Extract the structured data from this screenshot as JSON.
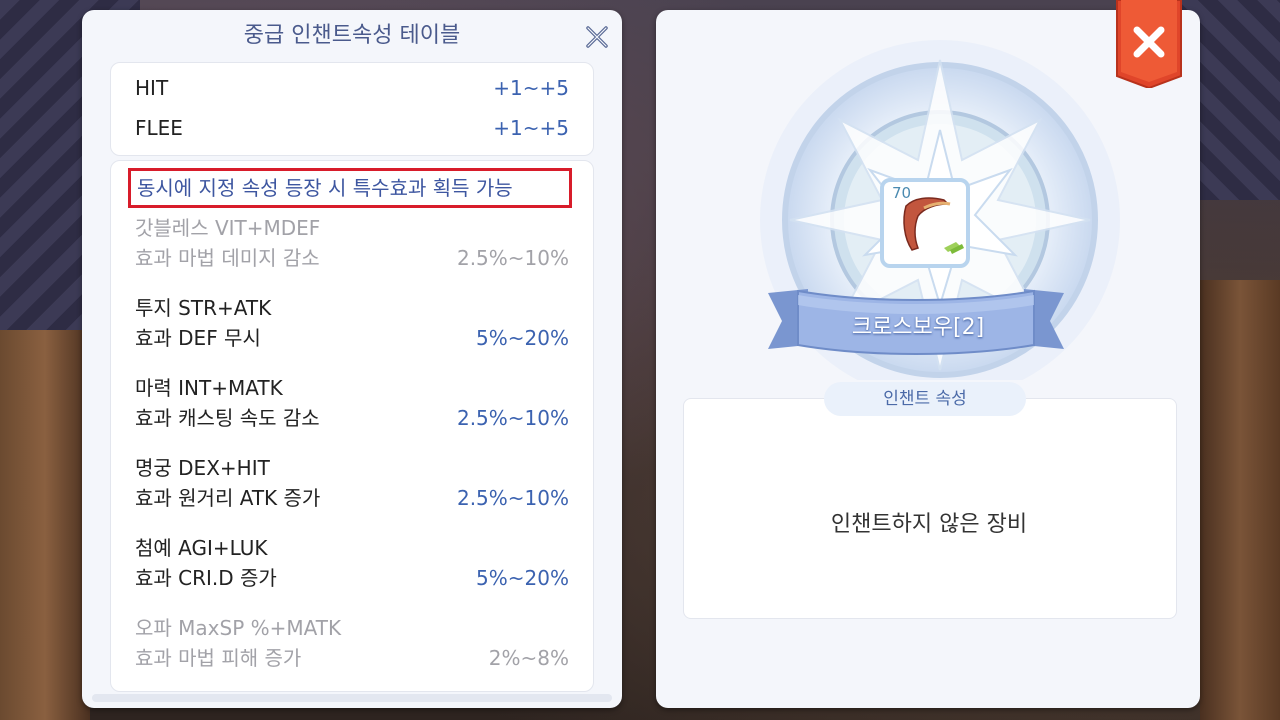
{
  "left_panel": {
    "title": "중급 인챈트속성 테이블",
    "stats": [
      {
        "name": "HIT",
        "range": "+1~+5"
      },
      {
        "name": "FLEE",
        "range": "+1~+5"
      }
    ],
    "notice": "동시에 지정 속성 등장 시 특수효과 획득 가능",
    "effects": [
      {
        "title": "갓블레스 VIT+MDEF",
        "desc": "효과 마법 데미지 감소",
        "range": "2.5%~10%",
        "dim": true
      },
      {
        "title": "투지 STR+ATK",
        "desc": "효과 DEF 무시",
        "range": "5%~20%",
        "dim": false
      },
      {
        "title": "마력 INT+MATK",
        "desc": "효과 캐스팅 속도 감소",
        "range": "2.5%~10%",
        "dim": false
      },
      {
        "title": "명궁 DEX+HIT",
        "desc": "효과 원거리 ATK 증가",
        "range": "2.5%~10%",
        "dim": false
      },
      {
        "title": "첨예 AGI+LUK",
        "desc": "효과 CRI.D 증가",
        "range": "5%~20%",
        "dim": false
      },
      {
        "title": "오파 MaxSP %+MATK",
        "desc": "효과 마법 피해 증가",
        "range": "2%~8%",
        "dim": true
      }
    ]
  },
  "right_panel": {
    "item_level": "70",
    "item_name": "크로스보우[2]",
    "section_label": "인챈트 속성",
    "empty_message": "인챈트하지 않은 장비"
  },
  "colors": {
    "accent_blue": "#3b62b0",
    "notice_border": "#d81c2a",
    "close_red": "#e0452a"
  },
  "icons": [
    "close-x-icon",
    "crossbow-item-icon",
    "close-tab-icon"
  ]
}
